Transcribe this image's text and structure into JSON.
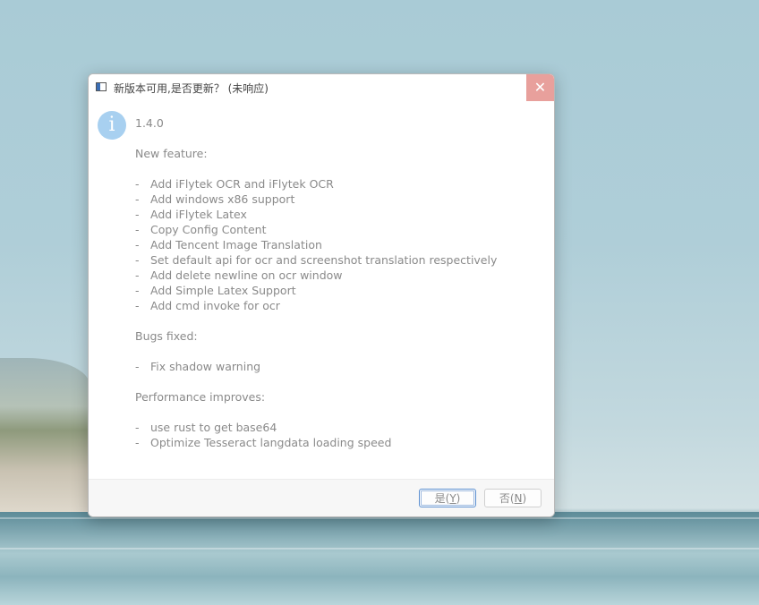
{
  "dialog": {
    "title": "新版本可用,是否更新？ (未响应)",
    "close_glyph": "✕",
    "info_glyph": "i",
    "version": "1.4.0",
    "new_feature_heading": "New feature:",
    "new_features": [
      "Add iFlytek OCR and iFlytek OCR",
      "Add windows x86 support",
      "Add iFlytek Latex",
      "Copy Config Content",
      "Add Tencent Image Translation",
      "Set default api for ocr and screenshot translation respectively",
      "Add delete newline on ocr window",
      "Add Simple Latex Support",
      "Add cmd invoke for ocr"
    ],
    "bugs_heading": "Bugs fixed:",
    "bugs": [
      "Fix shadow warning"
    ],
    "performance_heading": "Performance improves:",
    "performance": [
      "use rust to get base64",
      "Optimize Tesseract langdata loading speed"
    ],
    "bullet": "-",
    "yes_label": "是(Y)",
    "no_label": "否(N)"
  },
  "colors": {
    "close_bg": "#e8a09c",
    "info_icon_bg": "#a8d0f0",
    "text": "#8a8a8a",
    "default_button_border": "#5b8fd0"
  },
  "icons": {
    "app": "app-window-icon",
    "info": "info-icon",
    "close": "close-icon"
  }
}
